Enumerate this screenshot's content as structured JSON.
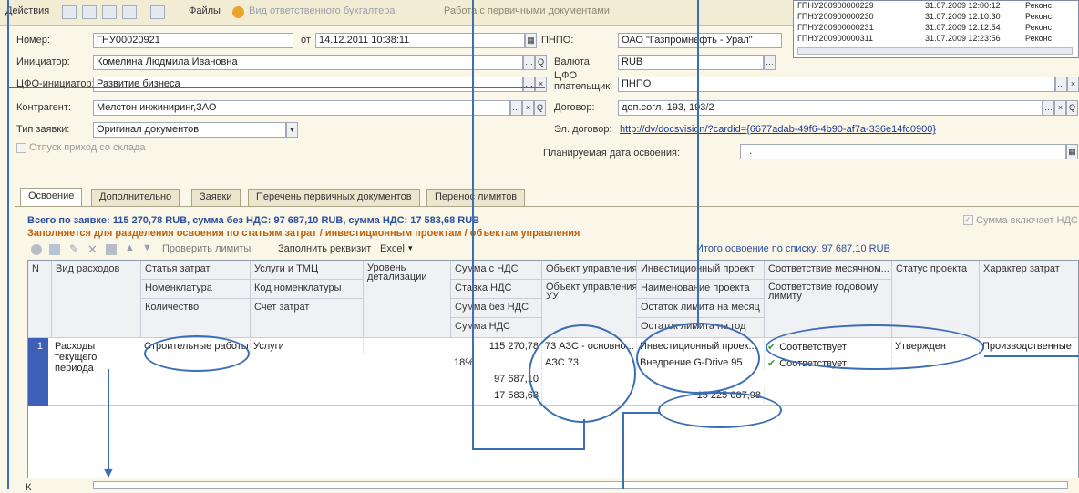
{
  "toolbar": {
    "actions": "Действия",
    "files": "Файлы",
    "mode_grey": "Вид ответственного бухгалтера",
    "mode": "Работа с первичными документами"
  },
  "popup": {
    "rows": [
      {
        "num": "ГПНУ200900000229",
        "date": "31.07.2009 12:00:12",
        "status": "Реконс"
      },
      {
        "num": "ГПНУ200900000230",
        "date": "31.07.2009 12:10:30",
        "status": "Реконс"
      },
      {
        "num": "ГПНУ200900000231",
        "date": "31.07.2009 12:12:54",
        "status": "Реконс"
      },
      {
        "num": "ГПНУ200900000311",
        "date": "31.07.2009 12:23:56",
        "status": "Реконс"
      }
    ]
  },
  "form": {
    "number_label": "Номер:",
    "number": "ГНУ00020921",
    "from_label": "от",
    "date": "14.12.2011 10:38:11",
    "pnpo_label": "ПНПО:",
    "pnpo": "ОАО \"Газпромнефть - Урал\"",
    "initiator_label": "Инициатор:",
    "initiator": "Комелина Людмила Ивановна",
    "currency_label": "Валюта:",
    "currency": "RUB",
    "cfo_label": "ЦФО-инициатор:",
    "cfo": "Развитие бизнеса",
    "cfo_payer_label_1": "ЦФО",
    "cfo_payer_label_2": "плательщик:",
    "cfo_payer": "ПНПО",
    "contractor_label": "Контрагент:",
    "contractor": "Мелстон инжиниринг,ЗАО",
    "contract_label": "Договор:",
    "contract": "доп.согл. 193, 193/2",
    "type_label": "Тип заявки:",
    "type": "Оригинал документов",
    "econtract_label": "Эл. договор:",
    "econtract": "http://dv/docsvision/?cardid={6677adab-49f6-4b90-af7a-336e14fc0900}",
    "warehouse_label": "Отпуск приход со склада",
    "plan_date_label": "Планируемая дата освоения:",
    "plan_date": ". ."
  },
  "tabs": [
    "Освоение",
    "Дополнительно",
    "Заявки",
    "Перечень первичных документов",
    "Перенос лимитов"
  ],
  "summary": {
    "total": "Всего по заявке: 115 270,78 RUB, сумма без НДС: 97 687,10 RUB, сумма НДС: 17 583,68 RUB",
    "vat_checkbox": "Сумма включает НДС",
    "instruction": "Заполняется для разделения освоения по статьям затрат / инвестиционным проектам / объектам управления"
  },
  "gridbar": {
    "check_limits": "Проверить лимиты",
    "fill_requisite": "Заполнить реквизит",
    "excel": "Excel",
    "total_list": "Итого освоение по списку: 97 687,10 RUB"
  },
  "columns": {
    "n": "N",
    "expense": "Вид расходов",
    "cost_item": "Статья затрат",
    "nomenclature": "Номенклатура",
    "quantity": "Количество",
    "services": "Услуги и ТМЦ",
    "nom_code": "Код номенклатуры",
    "cost_account": "Счет затрат",
    "level_1": "Уровень",
    "level_2": "детализации",
    "sum_vat": "Сумма с НДС",
    "vat_rate": "Ставка НДС",
    "sum_no_vat": "Сумма без НДС",
    "sum_vat_only": "Сумма НДС",
    "object": "Объект управления",
    "object_uu_1": "Объект управления",
    "object_uu_2": "УУ",
    "inv_project": "Инвестиционный проект",
    "project_name": "Наименование проекта",
    "limit_month": "Остаток лимита на месяц",
    "limit_year": "Остаток лимита на год",
    "match_month": "Соответствие месячном...",
    "match_year_1": "Соответствие годовому",
    "match_year_2": "лимиту",
    "project_status": "Статус проекта",
    "cost_nature": "Характер затрат"
  },
  "row": {
    "n": "1",
    "expense_1": "Расходы",
    "expense_2": "текущего",
    "expense_3": "периода",
    "cost_item": "Строительные работы",
    "services": "Услуги",
    "sum_vat": "115 270,78",
    "vat_rate": "18%",
    "sum_no_vat": "97 687,10",
    "sum_vat_only": "17 583,68",
    "object": "73 АЗС - основно...",
    "object_uu": "АЗС 73",
    "inv_project": "Инвестиционный проек...",
    "project_name": "Внедрение G-Drive 95",
    "limit_year": "15 225 087,98",
    "match_month": "Соответствует",
    "match_year": "Соответствует",
    "project_status": "Утвержден",
    "cost_nature": "Производственные"
  },
  "bottom": {
    "comment_label": "К"
  },
  "colors": {
    "accent": "#3b6fb4",
    "summary_blue": "#2a4ea0",
    "instruction_orange": "#c0600a",
    "link": "#1a3a9a"
  }
}
